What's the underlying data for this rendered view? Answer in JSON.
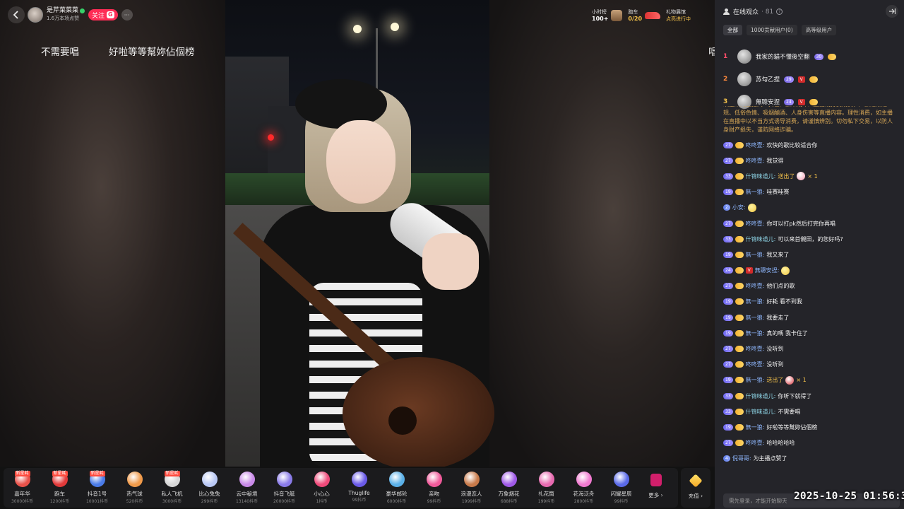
{
  "streamer": {
    "name": "是芹菜菜菜",
    "meta": "1.6万本场点赞",
    "follow_label": "关注",
    "follow_badge": "G",
    "more": "···"
  },
  "overlay_texts": [
    "不需要唱",
    "好啦等等幫妳佔個榜"
  ],
  "overlay_partial": "唱",
  "widgets": {
    "hourly_label": "小时榜",
    "hourly_value": "100+",
    "race_label": "跑车",
    "race_value": "0/20",
    "event_label": "礼物展馆",
    "event_sub": "点亮进行中"
  },
  "gifts": [
    {
      "name": "嘉年华",
      "price": "30000抖币",
      "badge": "新星耗",
      "color": "#e8524a"
    },
    {
      "name": "跑车",
      "price": "1200抖币",
      "badge": "新星耗",
      "color": "#e23a3a"
    },
    {
      "name": "抖音1号",
      "price": "10001抖币",
      "badge": "新星耗",
      "color": "#4a7be8"
    },
    {
      "name": "热气球",
      "price": "520抖币",
      "badge": "",
      "color": "#f09a4a"
    },
    {
      "name": "私人飞机",
      "price": "3000抖币",
      "badge": "新星耗",
      "color": "#d6d6d6"
    },
    {
      "name": "比心兔兔",
      "price": "299抖币",
      "badge": "",
      "color": "#b9c8f5"
    },
    {
      "name": "云中秘境",
      "price": "13140抖币",
      "badge": "",
      "color": "#c98ae8"
    },
    {
      "name": "抖音飞艇",
      "price": "20000抖币",
      "badge": "",
      "color": "#8a7be8"
    },
    {
      "name": "小心心",
      "price": "1抖币",
      "badge": "",
      "color": "#f04a7a"
    },
    {
      "name": "Thuglife",
      "price": "99抖币",
      "badge": "",
      "color": "#6a5ae8"
    },
    {
      "name": "豪华邮轮",
      "price": "6000抖币",
      "badge": "",
      "color": "#5ab0e8"
    },
    {
      "name": "亲吻",
      "price": "99抖币",
      "badge": "",
      "color": "#f05a9a"
    },
    {
      "name": "浪漫恋人",
      "price": "1999抖币",
      "badge": "",
      "color": "#c87a4a"
    },
    {
      "name": "万象烟花",
      "price": "688抖币",
      "badge": "",
      "color": "#a05ae8"
    },
    {
      "name": "礼花筒",
      "price": "199抖币",
      "badge": "",
      "color": "#e86ab0"
    },
    {
      "name": "花海泛舟",
      "price": "2800抖币",
      "badge": "",
      "color": "#f07ad0"
    },
    {
      "name": "闪耀星辰",
      "price": "99抖币",
      "badge": "",
      "color": "#5a6ae8"
    }
  ],
  "more_gifts_label": "更多 ›",
  "recharge_label": "充值 ›",
  "panel": {
    "title": "在线观众",
    "count": "· 81",
    "tabs": [
      "全部",
      "1000贡献用户(0)",
      "高等级用户"
    ],
    "rank": [
      {
        "num": "1",
        "name": "我家的貓不懂後空翻",
        "level": "30",
        "vip": false,
        "num_color": "#ff4d6a"
      },
      {
        "num": "2",
        "name": "苏勾乙捏",
        "level": "29",
        "vip": true,
        "num_color": "#ff8a3d"
      },
      {
        "num": "3",
        "name": "無聰安捏",
        "level": "24",
        "vip": true,
        "num_color": "#f6c34b"
      }
    ]
  },
  "notice": "欢迎来到直播间！抖音严禁未成年人直播或打赏消费，严禁违法违规、低俗色情、吸烟酗酒、人身伤害等直播内容。理性消费，如主播在直播中以不当方式诱导消费，请谨慎辨别。切勿私下交易，以防人身财产损失，谨防网络诈骗。",
  "chat": [
    {
      "level": "27",
      "user": "咚咚壹:",
      "msg": "欢快的歌比较适合你",
      "type": "text",
      "vip": false
    },
    {
      "level": "27",
      "user": "咚咚壹:",
      "msg": "我觉得",
      "type": "text",
      "vip": false
    },
    {
      "level": "33",
      "user": "什锦味道儿:",
      "msg": "送出了",
      "type": "gift",
      "count": "× 1",
      "gift_color": "#f29ab0",
      "vip": false
    },
    {
      "level": "19",
      "user": "無一狼:",
      "msg": "哇赛哇赛",
      "type": "text",
      "vip": false
    },
    {
      "level": "2",
      "user": "小安:",
      "msg": "",
      "type": "emoji",
      "emoji_color": "#f2c744",
      "vip": false
    },
    {
      "level": "27",
      "user": "咚咚壹:",
      "msg": "你可以打pk然后打完你再唱",
      "type": "text",
      "vip": false
    },
    {
      "level": "33",
      "user": "什锦味道儿:",
      "msg": "可以来首儭田，的您好吗?",
      "type": "text",
      "vip": false
    },
    {
      "level": "19",
      "user": "無一狼:",
      "msg": "我又来了",
      "type": "text",
      "vip": false
    },
    {
      "level": "24",
      "user": "無聰安捏:",
      "msg": "",
      "type": "emoji",
      "emoji_color": "#f2c744",
      "vip": true
    },
    {
      "level": "27",
      "user": "咚咚壹:",
      "msg": "他们点的歌",
      "type": "text",
      "vip": false
    },
    {
      "level": "19",
      "user": "無一狼:",
      "msg": "好耗 看不到我",
      "type": "text",
      "vip": false
    },
    {
      "level": "19",
      "user": "無一狼:",
      "msg": "我要走了",
      "type": "text",
      "vip": false
    },
    {
      "level": "19",
      "user": "無一狼:",
      "msg": "真的嗎 我卡住了",
      "type": "text",
      "vip": false
    },
    {
      "level": "27",
      "user": "咚咚壹:",
      "msg": "没听到",
      "type": "text",
      "vip": false
    },
    {
      "level": "27",
      "user": "咚咚壹:",
      "msg": "没听到",
      "type": "text",
      "vip": false
    },
    {
      "level": "19",
      "user": "無一狼:",
      "msg": "送出了",
      "type": "gift",
      "count": "× 1",
      "gift_color": "#d9363e",
      "vip": false
    },
    {
      "level": "33",
      "user": "什锦味道儿:",
      "msg": "你听下就得了",
      "type": "text",
      "vip": false
    },
    {
      "level": "33",
      "user": "什锦味道儿:",
      "msg": "不需要唱",
      "type": "text",
      "vip": false
    },
    {
      "level": "19",
      "user": "無一狼:",
      "msg": "好啦等等幫妳佔個榜",
      "type": "text",
      "vip": false
    },
    {
      "level": "27",
      "user": "咚咚壹:",
      "msg": "哈哈哈哈哈",
      "type": "text",
      "vip": false
    },
    {
      "level": "4",
      "user": "倪哥哥:",
      "msg": "为主播点赞了",
      "type": "text",
      "vip": false
    }
  ],
  "input_placeholder": "需先登录，才能开始聊天",
  "timestamp": "2025-10-25 01:56:32"
}
